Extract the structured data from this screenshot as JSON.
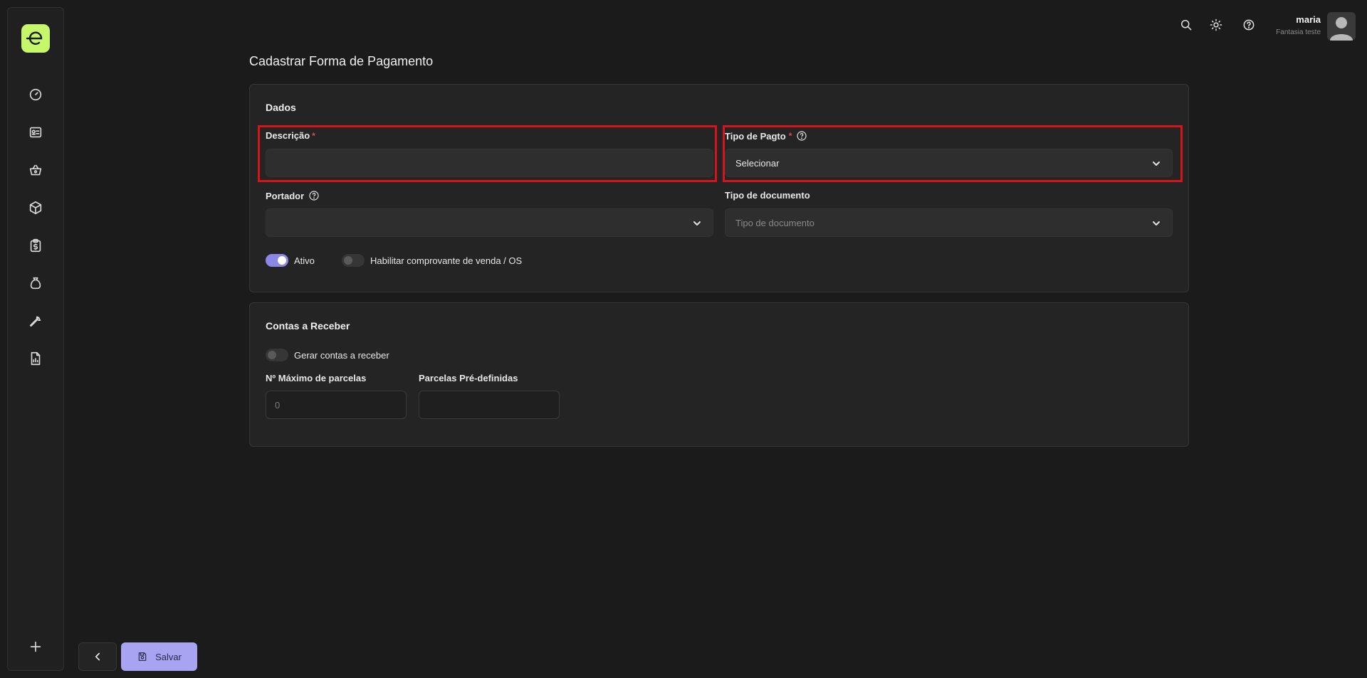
{
  "app": {
    "brand_color": "#c6f76a",
    "accent_color": "#a9a4f2",
    "highlight_color": "#d8141b"
  },
  "sidebar": {
    "items": [
      {
        "icon": "dashboard-gauge-icon"
      },
      {
        "icon": "contact-card-icon"
      },
      {
        "icon": "shopping-basket-icon"
      },
      {
        "icon": "box-icon"
      },
      {
        "icon": "clipboard-dollar-icon"
      },
      {
        "icon": "money-bag-icon"
      },
      {
        "icon": "wrench-icon"
      },
      {
        "icon": "report-chart-icon"
      }
    ],
    "add_icon": "plus-icon"
  },
  "topbar": {
    "user_name": "maria",
    "user_company": "Fantasia teste"
  },
  "page": {
    "title": "Cadastrar Forma de Pagamento"
  },
  "dados": {
    "title": "Dados",
    "descricao_label": "Descrição",
    "descricao_value": "",
    "required_mark": "*",
    "tipo_pagto_label": "Tipo de Pagto",
    "tipo_pagto_value": "Selecionar",
    "portador_label": "Portador",
    "portador_value": "",
    "tipo_documento_label": "Tipo de documento",
    "tipo_documento_placeholder": "Tipo de documento",
    "ativo_label": "Ativo",
    "ativo_on": true,
    "comprovante_label": "Habilitar comprovante de venda / OS",
    "comprovante_on": false
  },
  "contas": {
    "title": "Contas a Receber",
    "gerar_label": "Gerar contas a receber",
    "gerar_on": false,
    "max_parcelas_label": "Nº Máximo de parcelas",
    "max_parcelas_placeholder": "0",
    "parcelas_predef_label": "Parcelas Pré-definidas",
    "parcelas_predef_value": ""
  },
  "footer": {
    "save_label": "Salvar"
  }
}
